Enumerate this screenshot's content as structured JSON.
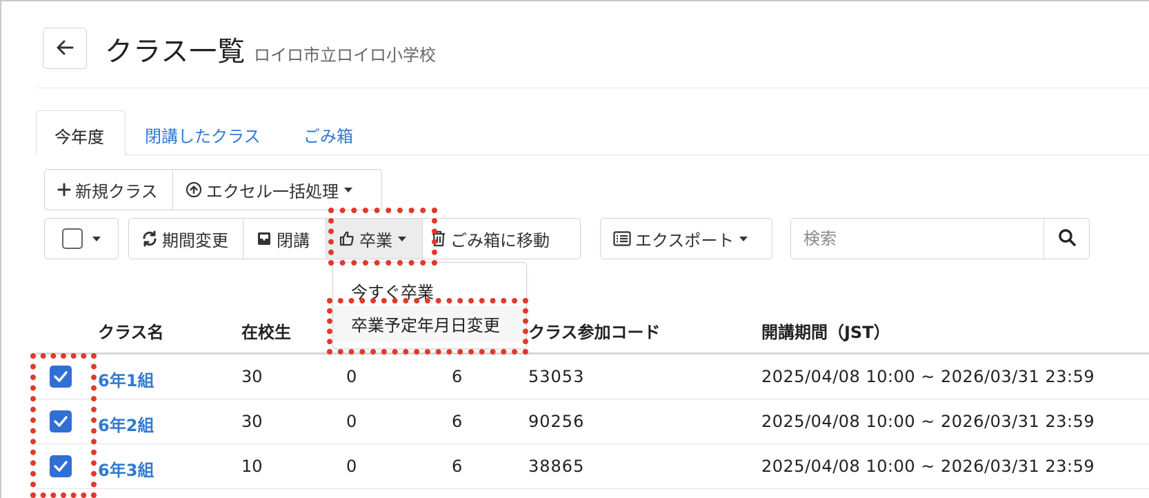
{
  "header": {
    "back_icon": "arrow-left-icon",
    "title": "クラス一覧",
    "subtitle": "ロイロ市立ロイロ小学校"
  },
  "tabs": [
    {
      "label": "今年度",
      "active": true
    },
    {
      "label": "閉講したクラス",
      "active": false
    },
    {
      "label": "ごみ箱",
      "active": false
    }
  ],
  "toolbar1": {
    "new_class": "新規クラス",
    "excel_bulk": "エクセル一括処理"
  },
  "toolbar2": {
    "period_change": "期間変更",
    "close": "閉講",
    "graduate": "卒業",
    "move_to_trash": "ごみ箱に移動",
    "export": "エクスポート"
  },
  "search": {
    "placeholder": "検索",
    "icon": "search-icon"
  },
  "graduate_menu": {
    "items": [
      "今すぐ卒業",
      "卒業予定年月日変更"
    ]
  },
  "table": {
    "headers": {
      "class_name": "クラス名",
      "students": "在校生",
      "join_code": "クラス参加コード",
      "period": "開講期間（JST）"
    },
    "rows": [
      {
        "name": "6年1組",
        "students": "30",
        "col3": "0",
        "col4": "6",
        "code": "53053",
        "period": "2025/04/08 10:00 ~ 2026/03/31 23:59",
        "checked": true
      },
      {
        "name": "6年2組",
        "students": "30",
        "col3": "0",
        "col4": "6",
        "code": "90256",
        "period": "2025/04/08 10:00 ~ 2026/03/31 23:59",
        "checked": true
      },
      {
        "name": "6年3組",
        "students": "10",
        "col3": "0",
        "col4": "6",
        "code": "38865",
        "period": "2025/04/08 10:00 ~ 2026/03/31 23:59",
        "checked": true
      }
    ]
  },
  "colors": {
    "link": "#2f7ad1",
    "checkbox": "#2f6fd6",
    "annotation": "#e03a2a"
  }
}
